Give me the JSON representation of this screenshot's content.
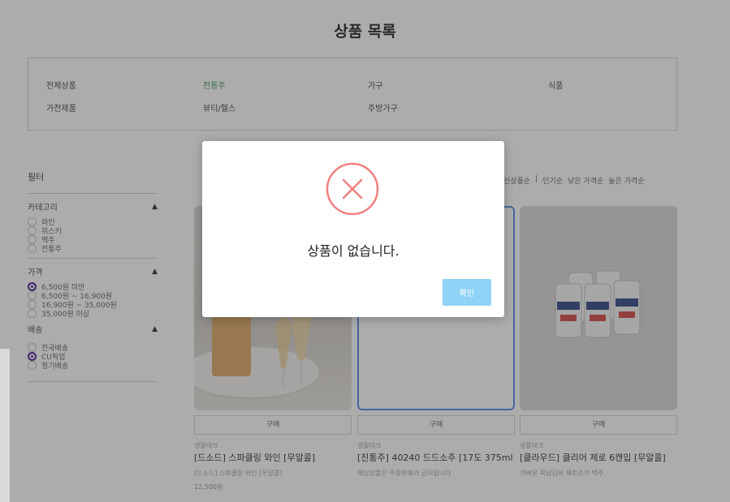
{
  "page": {
    "title": "상품 목록"
  },
  "categories": {
    "row1": [
      {
        "label": "전체상품",
        "active": false
      },
      {
        "label": "전통주",
        "active": true
      },
      {
        "label": "가구",
        "active": false
      },
      {
        "label": "식품",
        "active": false
      }
    ],
    "row2": [
      {
        "label": "가전제품",
        "active": false
      },
      {
        "label": "뷰티/헬스",
        "active": false
      },
      {
        "label": "주방가구",
        "active": false
      }
    ]
  },
  "filters": {
    "title": "필터",
    "category": {
      "label": "카테고리",
      "options": [
        "와인",
        "위스키",
        "맥주",
        "전통주"
      ]
    },
    "price": {
      "label": "가격",
      "options": [
        "6,500원 미만",
        "6,500원 ~ 16,900원",
        "16,900원 ~ 35,000원",
        "35,000원 이상"
      ],
      "selected": 0
    },
    "delivery": {
      "label": "배송",
      "options": [
        "전국배송",
        "CU픽업",
        "정기배송"
      ],
      "selected": 1
    }
  },
  "sort": [
    "신상품순",
    "인기순",
    "낮은 가격순",
    "높은 가격순"
  ],
  "products": [
    {
      "buy_label": "구매",
      "brand": "생활테크",
      "name": "[드소드] 스파클링 와인 [무알콜]",
      "desc": "[드소드] 스파클링 와인 [무알콜]",
      "price": "12,500원"
    },
    {
      "buy_label": "구매",
      "brand": "생활테크",
      "name": "[진통주] 40240 드드소주 [17도 375ml",
      "desc": "해당상품은 주류판매가 금지됩니다",
      "price": ""
    },
    {
      "buy_label": "구매",
      "brand": "생활테크",
      "name": "[클라우드] 클리어 제로 6캔입 [무알콜]",
      "desc": "가벼운 목넘김의 제로슈가 맥주",
      "price": ""
    }
  ],
  "modal": {
    "message": "상품이 없습니다.",
    "confirm_label": "확인"
  },
  "colors": {
    "error_ring": "#f08080",
    "confirm_button": "#8fd3f6",
    "radio_selected": "#3b0b8c"
  }
}
